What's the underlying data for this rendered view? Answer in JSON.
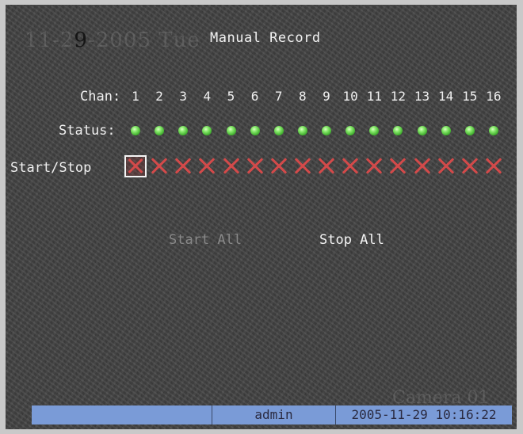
{
  "overlay": {
    "date_prefix": "11-2",
    "date_highlight": "9",
    "date_rest": "-2005 Tue"
  },
  "title": "Manual Record",
  "labels": {
    "chan": "Chan:",
    "status": "Status:",
    "start_stop": "Start/Stop"
  },
  "channels": [
    "1",
    "2",
    "3",
    "4",
    "5",
    "6",
    "7",
    "8",
    "9",
    "10",
    "11",
    "12",
    "13",
    "14",
    "15",
    "16"
  ],
  "channel_status_color": "#4fbf3a",
  "stop_mark_color": "#d34a4a",
  "selected_channel": "1",
  "actions": {
    "start_all": "Start All",
    "stop_all": "Stop All"
  },
  "watermark": "Camera 01",
  "statusbar": {
    "user": "admin",
    "datetime": "2005-11-29 10:16:22"
  }
}
